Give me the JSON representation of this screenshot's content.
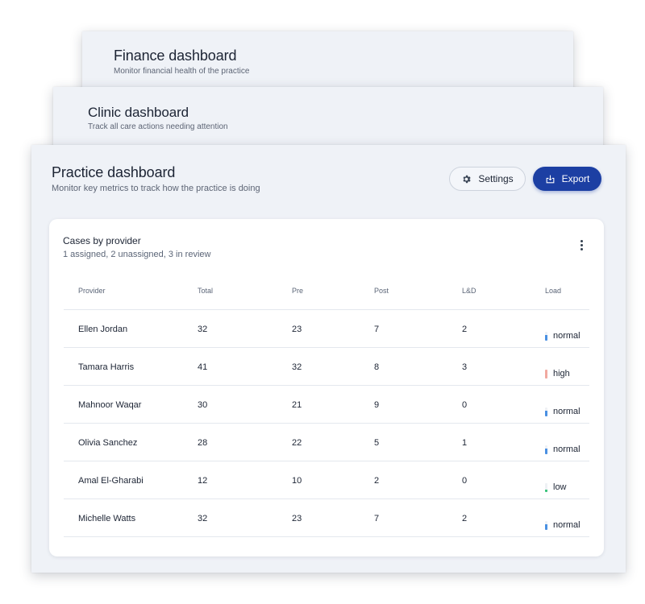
{
  "finance": {
    "title": "Finance dashboard",
    "subtitle": "Monitor financial health of the practice"
  },
  "clinic": {
    "title": "Clinic dashboard",
    "subtitle": "Track all care actions needing attention"
  },
  "practice": {
    "title": "Practice dashboard",
    "subtitle": "Monitor key metrics to track how the practice is doing",
    "settings_label": "Settings",
    "settings_icon": "gear-icon",
    "export_label": "Export",
    "export_icon": "download-box-icon",
    "accent_color": "#1c3fa3"
  },
  "cases": {
    "title": "Cases by provider",
    "summary": "1 assigned, 2 unassigned, 3 in review",
    "menu_icon": "more-vertical-icon",
    "headers": [
      "Provider",
      "Total",
      "Pre",
      "Post",
      "L&D",
      "Load"
    ],
    "rows": [
      {
        "provider": "Ellen Jordan",
        "total": "32",
        "pre": "23",
        "post": "7",
        "ld": "2",
        "load": "normal"
      },
      {
        "provider": "Tamara Harris",
        "total": "41",
        "pre": "32",
        "post": "8",
        "ld": "3",
        "load": "high"
      },
      {
        "provider": "Mahnoor Waqar",
        "total": "30",
        "pre": "21",
        "post": "9",
        "ld": "0",
        "load": "normal"
      },
      {
        "provider": "Olivia Sanchez",
        "total": "28",
        "pre": "22",
        "post": "5",
        "ld": "1",
        "load": "normal"
      },
      {
        "provider": "Amal El-Gharabi",
        "total": "12",
        "pre": "10",
        "post": "2",
        "ld": "0",
        "load": "low"
      },
      {
        "provider": "Michelle Watts",
        "total": "32",
        "pre": "23",
        "post": "7",
        "ld": "2",
        "load": "normal"
      }
    ],
    "load_levels": {
      "low": {
        "color": "#3cc47c",
        "fraction": 0.2
      },
      "normal": {
        "color": "#4a90e2",
        "fraction": 0.6
      },
      "high": {
        "color": "#f1a9a0",
        "fraction": 1.0
      }
    }
  }
}
